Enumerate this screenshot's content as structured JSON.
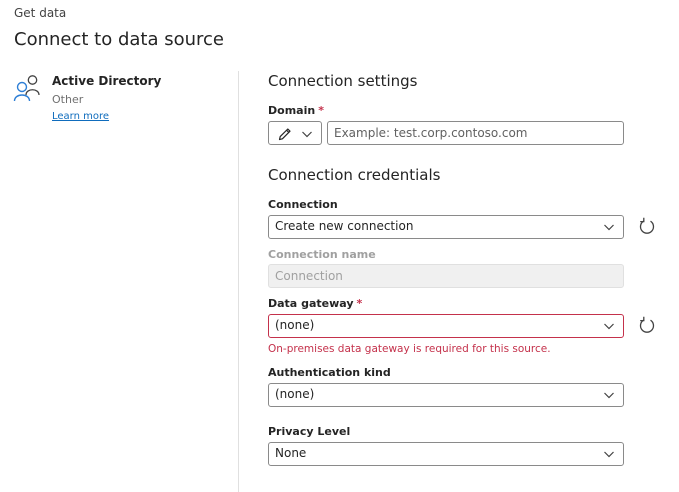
{
  "header": {
    "breadcrumb": "Get data",
    "title": "Connect to data source"
  },
  "connector": {
    "name": "Active Directory",
    "category": "Other",
    "learn_more": "Learn more"
  },
  "connection_settings": {
    "title": "Connection settings",
    "domain_label": "Domain",
    "required_mark": "*",
    "domain_placeholder": "Example: test.corp.contoso.com",
    "domain_value": ""
  },
  "connection_credentials": {
    "title": "Connection credentials",
    "connection_label": "Connection",
    "connection_value": "Create new connection",
    "connection_name_label": "Connection name",
    "connection_name_placeholder": "Connection",
    "gateway_label": "Data gateway",
    "gateway_required_mark": "*",
    "gateway_value": "(none)",
    "gateway_error": "On-premises data gateway is required for this source.",
    "auth_label": "Authentication kind",
    "auth_value": "(none)",
    "privacy_label": "Privacy Level",
    "privacy_value": "None"
  },
  "icons": {
    "connector": "users-icon",
    "edit": "pencil-icon",
    "dropdown": "chevron-down-icon",
    "refresh": "refresh-icon"
  },
  "colors": {
    "accent": "#0f6cbd",
    "error": "#c4314b",
    "icon_blue": "#2e7fd6"
  }
}
